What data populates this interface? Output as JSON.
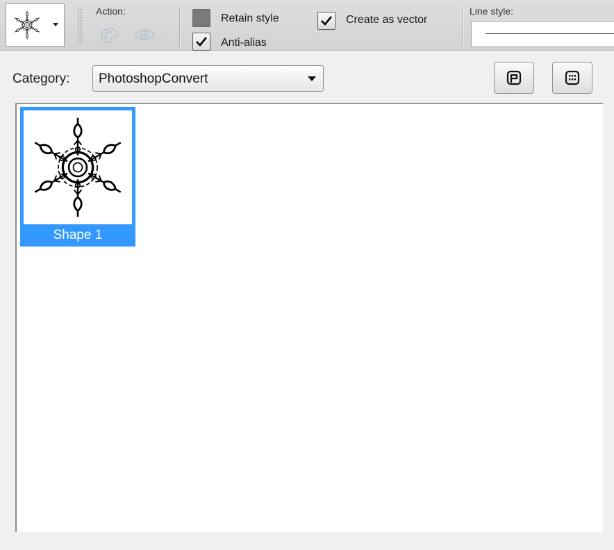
{
  "toolbar": {
    "shape_picker": {
      "icon": "snowflake-shape-icon"
    },
    "action_label": "Action:",
    "action_icons": [
      "palette-icon",
      "eye-icon"
    ],
    "retain_style": {
      "label": "Retain style",
      "checked": false
    },
    "anti_alias": {
      "label": "Anti-alias",
      "checked": true
    },
    "create_as_vector": {
      "label": "Create as vector",
      "checked": true
    },
    "line_style_label": "Line style:"
  },
  "category": {
    "label": "Category:",
    "selected": "PhotoshopConvert"
  },
  "view_buttons": [
    "single-view-icon",
    "grid-view-icon"
  ],
  "shapes": [
    {
      "name": "Shape 1",
      "selected": true,
      "icon": "snowflake-shape-icon"
    }
  ],
  "colors": {
    "selection": "#3399ff",
    "toolbar_bg": "#d6d6d6",
    "panel_bg": "#f0f0f0"
  }
}
